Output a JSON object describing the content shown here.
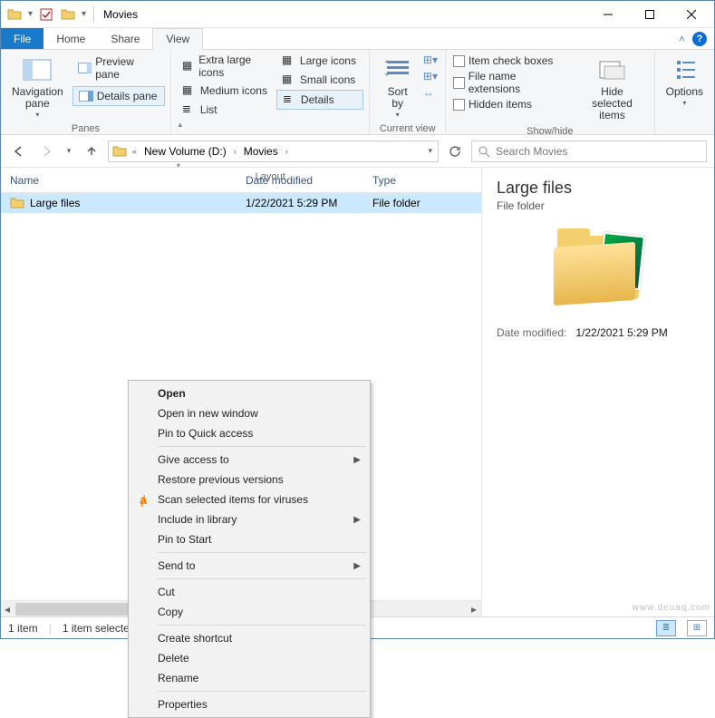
{
  "title": "Movies",
  "menu": {
    "file": "File",
    "home": "Home",
    "share": "Share",
    "view": "View"
  },
  "ribbon": {
    "panes": {
      "label": "Panes",
      "navigation": "Navigation pane",
      "preview": "Preview pane",
      "details": "Details pane"
    },
    "layout": {
      "label": "Layout",
      "xl": "Extra large icons",
      "l": "Large icons",
      "m": "Medium icons",
      "s": "Small icons",
      "list": "List",
      "details": "Details"
    },
    "currentview": {
      "label": "Current view",
      "sortby": "Sort by"
    },
    "showhide": {
      "label": "Show/hide",
      "checkboxes": "Item check boxes",
      "ext": "File name extensions",
      "hidden": "Hidden items",
      "hidesel": "Hide selected items"
    },
    "options": "Options"
  },
  "address": {
    "seg1": "New Volume (D:)",
    "seg2": "Movies"
  },
  "search_placeholder": "Search Movies",
  "columns": {
    "name": "Name",
    "date": "Date modified",
    "type": "Type"
  },
  "row": {
    "name": "Large files",
    "date": "1/22/2021 5:29 PM",
    "type": "File folder"
  },
  "details": {
    "title": "Large files",
    "kind": "File folder",
    "dm_label": "Date modified:",
    "dm_value": "1/22/2021 5:29 PM"
  },
  "context": {
    "open": "Open",
    "open_new": "Open in new window",
    "pin_qa": "Pin to Quick access",
    "give_access": "Give access to",
    "restore": "Restore previous versions",
    "scan": "Scan selected items for viruses",
    "include": "Include in library",
    "pin_start": "Pin to Start",
    "send_to": "Send to",
    "cut": "Cut",
    "copy": "Copy",
    "shortcut": "Create shortcut",
    "delete": "Delete",
    "rename": "Rename",
    "properties": "Properties"
  },
  "status": {
    "count": "1 item",
    "selected": "1 item selected"
  },
  "watermark": "www.deuaq.com"
}
